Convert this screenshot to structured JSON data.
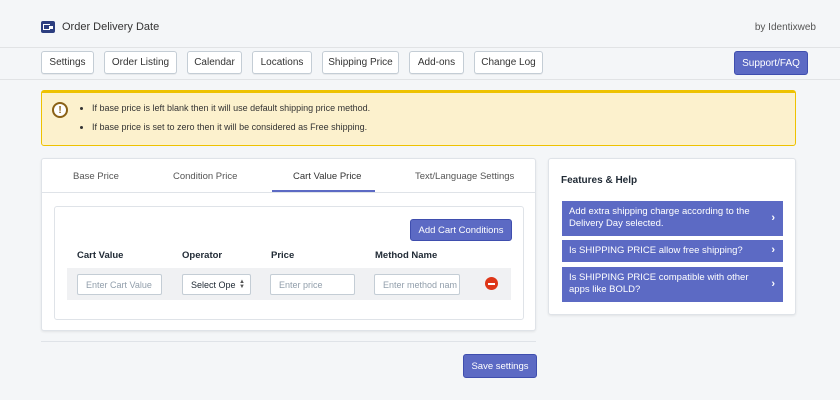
{
  "app": {
    "title": "Order Delivery Date",
    "by": "by Identixweb"
  },
  "nav": {
    "items": [
      "Settings",
      "Order Listing",
      "Calendar",
      "Locations",
      "Shipping Price",
      "Add-ons",
      "Change Log"
    ],
    "support": "Support/FAQ"
  },
  "notice": {
    "icon": "alert-icon",
    "lines": [
      "If base price is left blank then it will use default shipping price method.",
      "If base price is set to zero then it will be considered as Free shipping."
    ]
  },
  "tabs": {
    "items": [
      "Base Price",
      "Condition Price",
      "Cart Value Price",
      "Text/Language Settings"
    ],
    "active": "Cart Value Price"
  },
  "cart": {
    "add_button": "Add Cart Conditions",
    "headers": [
      "Cart Value",
      "Operator",
      "Price",
      "Method Name"
    ],
    "row": {
      "cart_value_placeholder": "Enter Cart Value",
      "operator_value": "Select Ope",
      "price_placeholder": "Enter price",
      "method_placeholder": "Enter method nam"
    }
  },
  "save_button": "Save settings",
  "help": {
    "title": "Features & Help",
    "items": [
      "Add extra shipping charge according to the Delivery Day selected.",
      "Is SHIPPING PRICE allow free shipping?",
      "Is SHIPPING PRICE compatible with other apps like BOLD?"
    ]
  },
  "colors": {
    "accent": "#5c6ac4",
    "warning_bg": "#fcf1cd",
    "warning_border": "#eec200",
    "danger": "#de3618"
  }
}
